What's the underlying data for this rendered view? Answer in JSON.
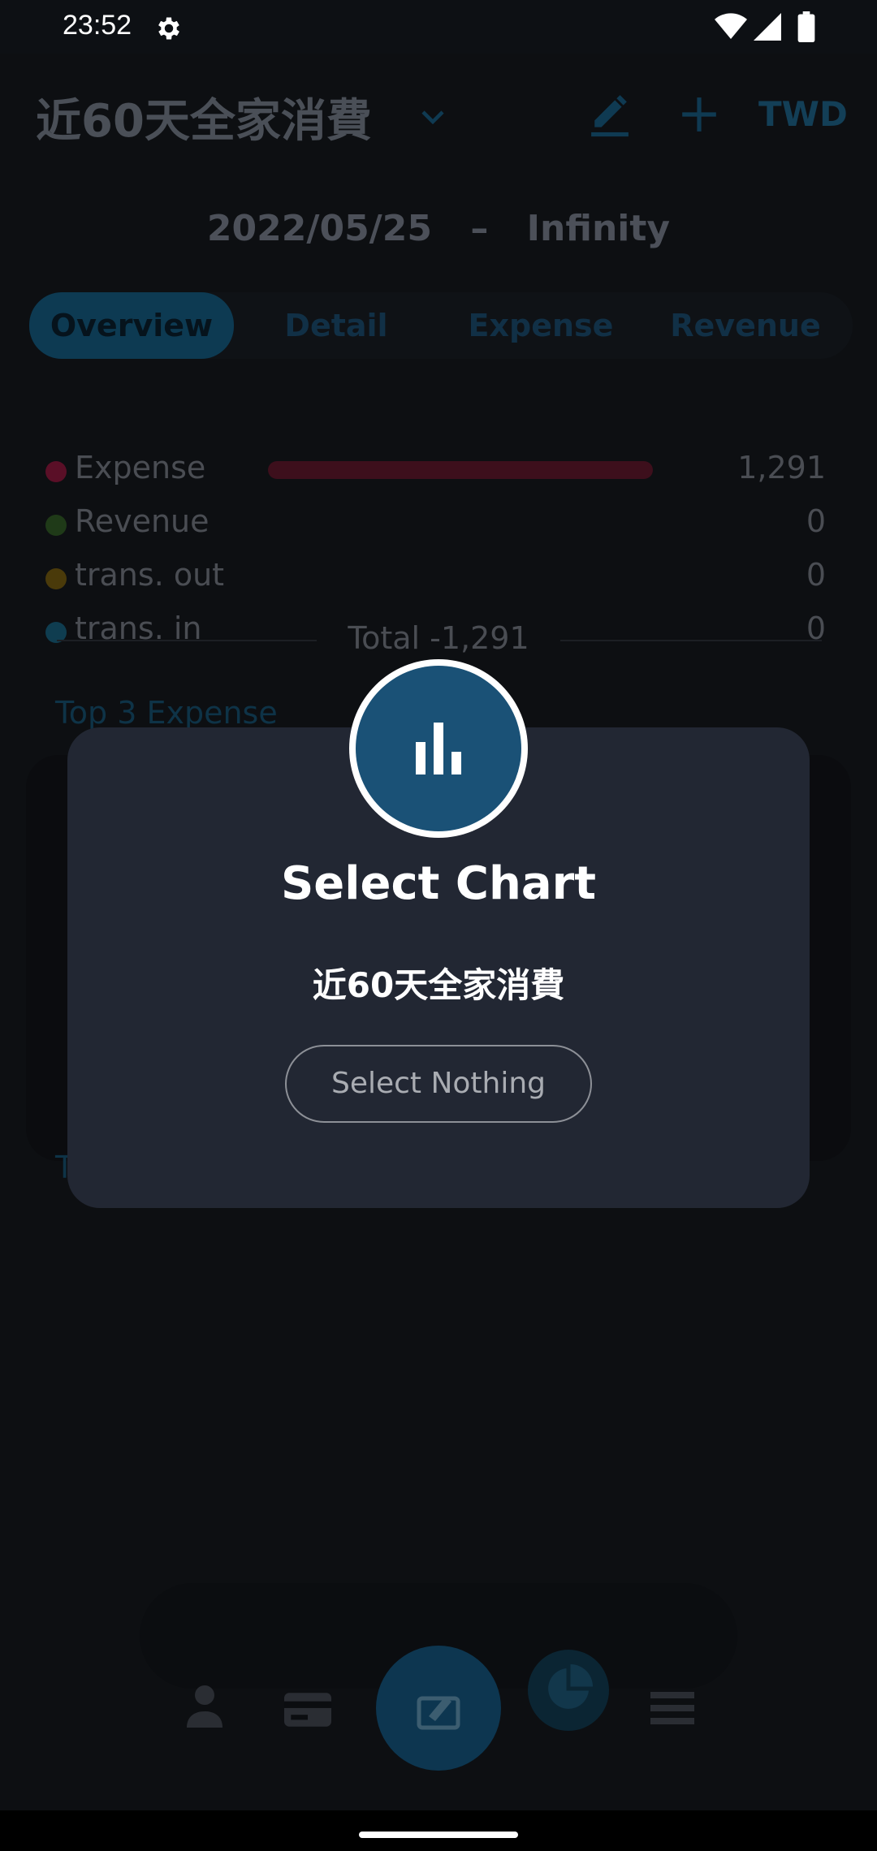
{
  "status_bar": {
    "time": "23:52",
    "icons": [
      "gear-icon",
      "wifi-icon",
      "signal-icon",
      "battery-icon"
    ]
  },
  "header": {
    "book_title": "近60天全家消費",
    "currency": "TWD",
    "icons": [
      "chevron-down-icon",
      "edit-icon",
      "add-icon"
    ]
  },
  "date_range": {
    "start": "2022/05/25",
    "separator": "–",
    "end": "Infinity"
  },
  "tabs": [
    {
      "label": "Overview",
      "active": true
    },
    {
      "label": "Detail",
      "active": false
    },
    {
      "label": "Expense",
      "active": false
    },
    {
      "label": "Revenue",
      "active": false
    }
  ],
  "summary": [
    {
      "label": "Expense",
      "value": "1,291",
      "color": "#5a0f27"
    },
    {
      "label": "Revenue",
      "value": "0",
      "color": "#1f3a18"
    },
    {
      "label": "trans. out",
      "value": "0",
      "color": "#4a3a0a"
    },
    {
      "label": "trans. in",
      "value": "0",
      "color": "#0f3d50"
    }
  ],
  "total_text": "Total -1,291",
  "top3_title": "Top 3 Expense",
  "partial_heading": "T",
  "bottom_nav": [
    "person-icon",
    "card-icon",
    "add-record-icon",
    "pie-chart-icon",
    "list-icon"
  ],
  "dialog": {
    "icon": "bar-chart-icon",
    "title": "Select Chart",
    "subtitle": "近60天全家消費",
    "button_label": "Select Nothing"
  },
  "colors": {
    "dialog_bg": "#222733",
    "accent": "#1a5176",
    "background": "#0d0f12"
  }
}
